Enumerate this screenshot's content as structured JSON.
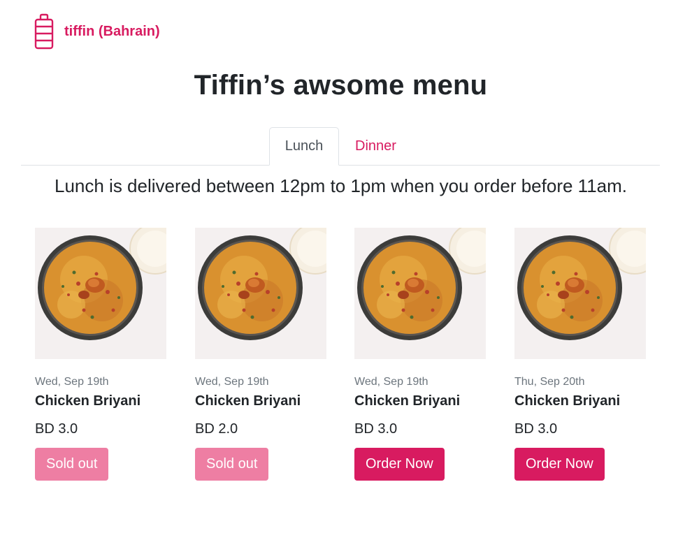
{
  "brand": {
    "name": "tiffin (Bahrain)",
    "icon": "tiffin-carrier-icon",
    "color": "#d81b60"
  },
  "page": {
    "title": "Tiffin’s awsome menu"
  },
  "tabs": [
    {
      "label": "Lunch",
      "active": true
    },
    {
      "label": "Dinner",
      "active": false
    }
  ],
  "intro": "Lunch is delivered between 12pm to 1pm when you order before 11am.",
  "items": [
    {
      "date": "Wed, Sep 19th",
      "name": "Chicken Briyani",
      "price": "BD 3.0",
      "button": "Sold out",
      "status": "sold-out",
      "image": "biryani-bowl-photo"
    },
    {
      "date": "Wed, Sep 19th",
      "name": "Chicken Briyani",
      "price": "BD 2.0",
      "button": "Sold out",
      "status": "sold-out",
      "image": "biryani-bowl-photo"
    },
    {
      "date": "Wed, Sep 19th",
      "name": "Chicken Briyani",
      "price": "BD 3.0",
      "button": "Order Now",
      "status": "available",
      "image": "biryani-bowl-photo"
    },
    {
      "date": "Thu, Sep 20th",
      "name": "Chicken Briyani",
      "price": "BD 3.0",
      "button": "Order Now",
      "status": "available",
      "image": "biryani-bowl-photo"
    }
  ],
  "colors": {
    "accent": "#d81b60",
    "sold_out": "#ee7ea3",
    "muted_text": "#6c757d"
  }
}
